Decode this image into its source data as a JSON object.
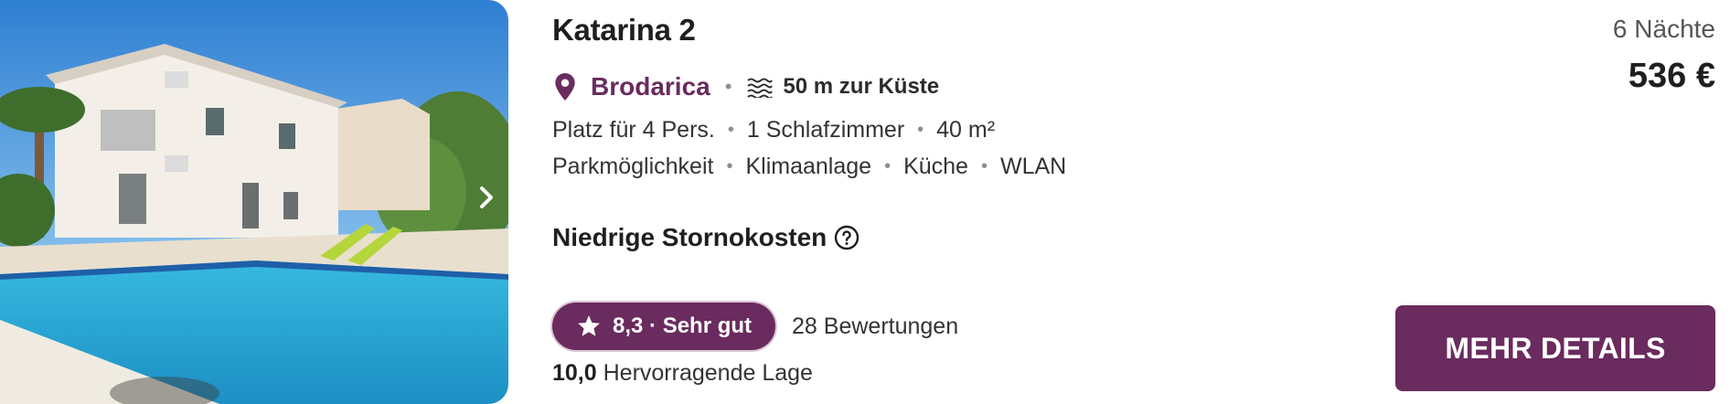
{
  "listing": {
    "title": "Katarina 2",
    "location": "Brodarica",
    "coast_distance": "50 m zur Küste",
    "facts_primary": [
      "Platz für 4 Pers.",
      "1 Schlafzimmer",
      "40 m²"
    ],
    "facts_amenities": [
      "Parkmöglichkeit",
      "Klimaanlage",
      "Küche",
      "WLAN"
    ],
    "cancellation": "Niedrige Stornokosten",
    "rating": {
      "badge_text": "8,3 · Sehr gut",
      "reviews": "28 Bewertungen",
      "location_score": "10,0",
      "location_label": "Hervorragende Lage"
    },
    "nights": "6 Nächte",
    "price": "536 €",
    "cta_label": "MEHR DETAILS"
  },
  "icons": {
    "location": "map-pin-icon",
    "coast": "waves-icon",
    "help": "question-circle-icon",
    "star": "star-icon",
    "next": "chevron-right-icon"
  },
  "colors": {
    "brand": "#6a2b5e",
    "text": "#1f1f1f",
    "muted": "#555555"
  }
}
